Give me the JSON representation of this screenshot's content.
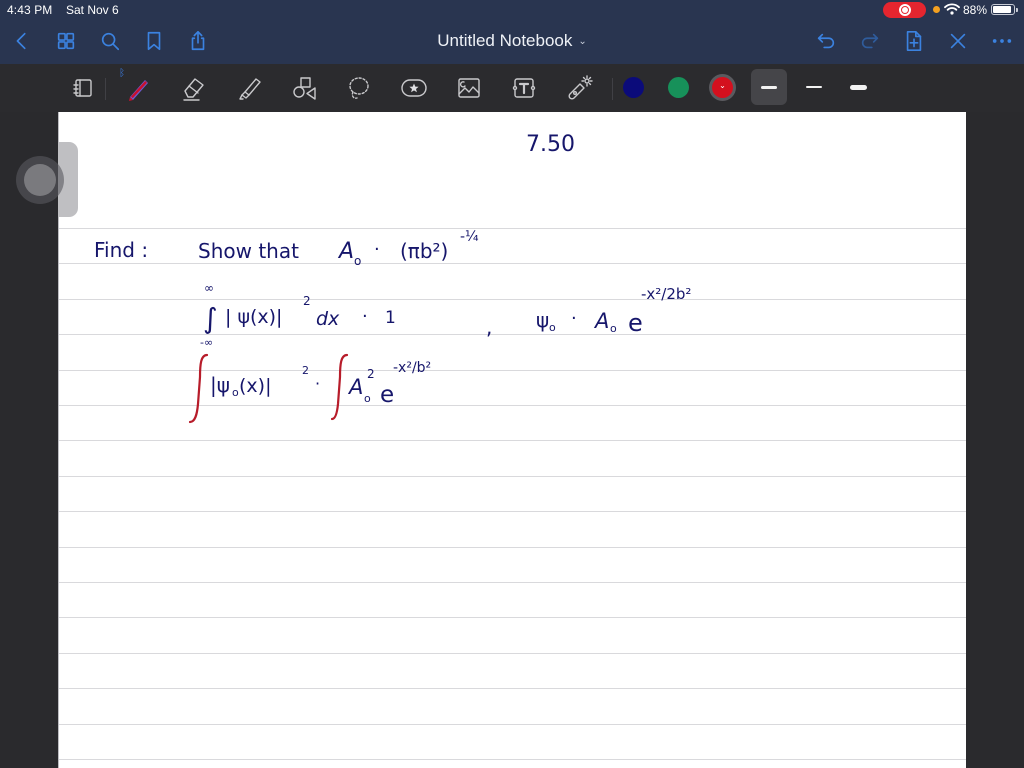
{
  "status_bar": {
    "time": "4:43 PM",
    "date": "Sat Nov 6",
    "battery_percent": "88%",
    "battery_level": 0.88,
    "recording": true
  },
  "nav": {
    "title": "Untitled Notebook",
    "title_chevron": "⌄",
    "left_icons": [
      "back-icon",
      "thumbnails-grid-icon",
      "search-icon",
      "bookmark-icon",
      "share-icon"
    ],
    "right_icons": [
      "undo-icon",
      "redo-icon",
      "add-page-icon",
      "close-toolbar-icon",
      "more-icon"
    ]
  },
  "toolbar": {
    "tools": [
      "page-layout-icon",
      "pen-icon",
      "eraser-icon",
      "highlighter-icon",
      "shapes-icon",
      "lasso-icon",
      "sticker-icon",
      "image-icon",
      "text-icon",
      "laser-pointer-icon"
    ],
    "active_tool": "pen",
    "bluetooth_indicator": "ᛒ",
    "colors": [
      "#0b0b7a",
      "#17915a",
      "#d4101e"
    ],
    "selected_color": "#d4101e",
    "stroke_widths": [
      "medium",
      "thin",
      "thick"
    ],
    "selected_stroke": "medium"
  },
  "page": {
    "problem_number": "7.50",
    "lines": [
      {
        "label": "Find :",
        "statement": "Show that",
        "lhs": "A",
        "lhs_sub": "o",
        "eq": "·",
        "rhs": "(πb²)",
        "rhs_exp": "-¼"
      },
      {
        "integral_upper": "∞",
        "integral_lower": "-∞",
        "integrand": "| ψ(x)|",
        "power": "2",
        "dx": "dx",
        "eq": "·",
        "value": "1",
        "comma": ",",
        "psi0": "ψ",
        "psi0_sub": "o",
        "eq2": "·",
        "A0": "A",
        "A0_sub": "o",
        "e": "e",
        "exp": "-x²/2b²"
      },
      {
        "integrand": "|ψ",
        "integrand_sub": "o",
        "integrand_rest": "(x)|",
        "power": "2",
        "eq": "·",
        "A": "A",
        "A_sub": "o",
        "A_pow": "2",
        "e": "e",
        "exp": "-x²/b²"
      }
    ]
  }
}
